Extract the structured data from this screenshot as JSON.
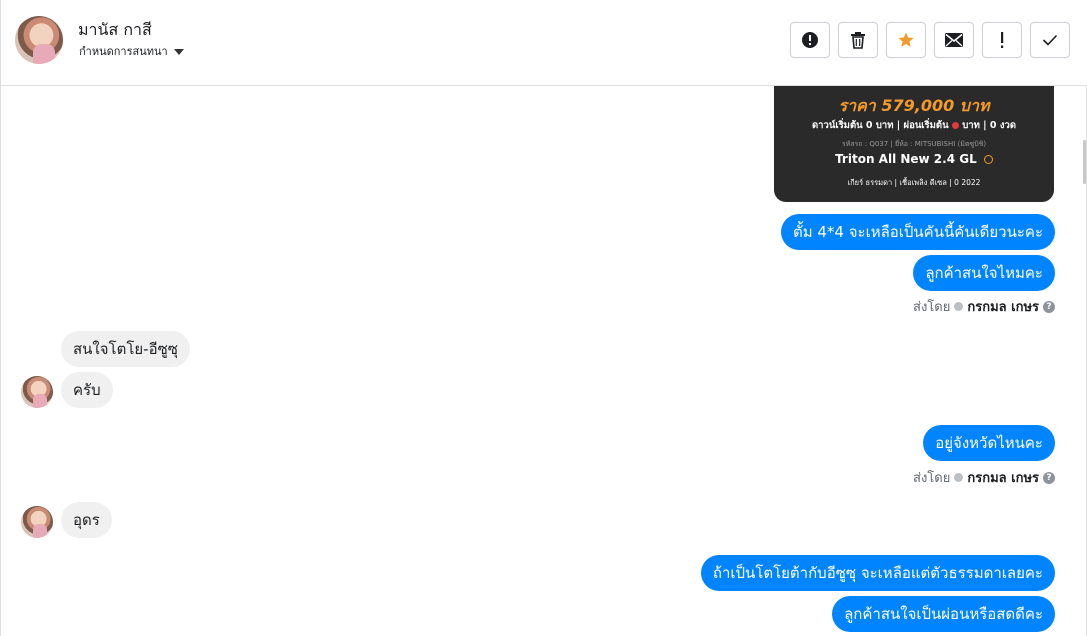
{
  "header": {
    "contact_name": "มานัส กาสี",
    "assign_label": "กำหนดการสนทนา"
  },
  "toolbar": {
    "buttons": [
      "alert-circle-icon",
      "trash-icon",
      "star-icon",
      "envelope-icon",
      "exclamation-icon",
      "check-icon"
    ],
    "star_color": "#f39a2a"
  },
  "car_card": {
    "price": "ราคา 579,000 บาท",
    "down_pre": "ดาวน์เริ่มต้น 0 บาท | ผ่อนเริ่มต้น",
    "down_post": "บาท | 0 งวด",
    "code": "รหัสรถ : Q037 | ยี่ห้อ : MITSUBISHI (มิตซูบิชิ)",
    "model": "Triton All New 2.4 GL",
    "specs": "เกียร์ ธรรมดา | เชื้อเพลิง ดีเซล | 0 2022"
  },
  "messages": {
    "out_1": "ตั้ม 4*4 จะเหลือเป็นคันนี้คันเดียวนะคะ",
    "out_2": "ลูกค้าสนใจไหมคะ",
    "in_1": "สนใจโตโย-อีซูซุ",
    "in_2": "ครับ",
    "out_3": "อยู่จังหวัดไหนคะ",
    "in_3": "อุดร",
    "out_4": "ถ้าเป็นโตโยต้ากับอีซูซุ จะเหลือแต่ตัวธรรมดาเลยคะ",
    "out_5": "ลูกค้าสนใจเป็นผ่อนหรือสดดีคะ"
  },
  "sent_by": {
    "label": "ส่งโดย",
    "agent": "กรกมล เกษร"
  },
  "colors": {
    "outgoing_bubble": "#0084ff",
    "incoming_bubble": "#f0f0f0"
  }
}
